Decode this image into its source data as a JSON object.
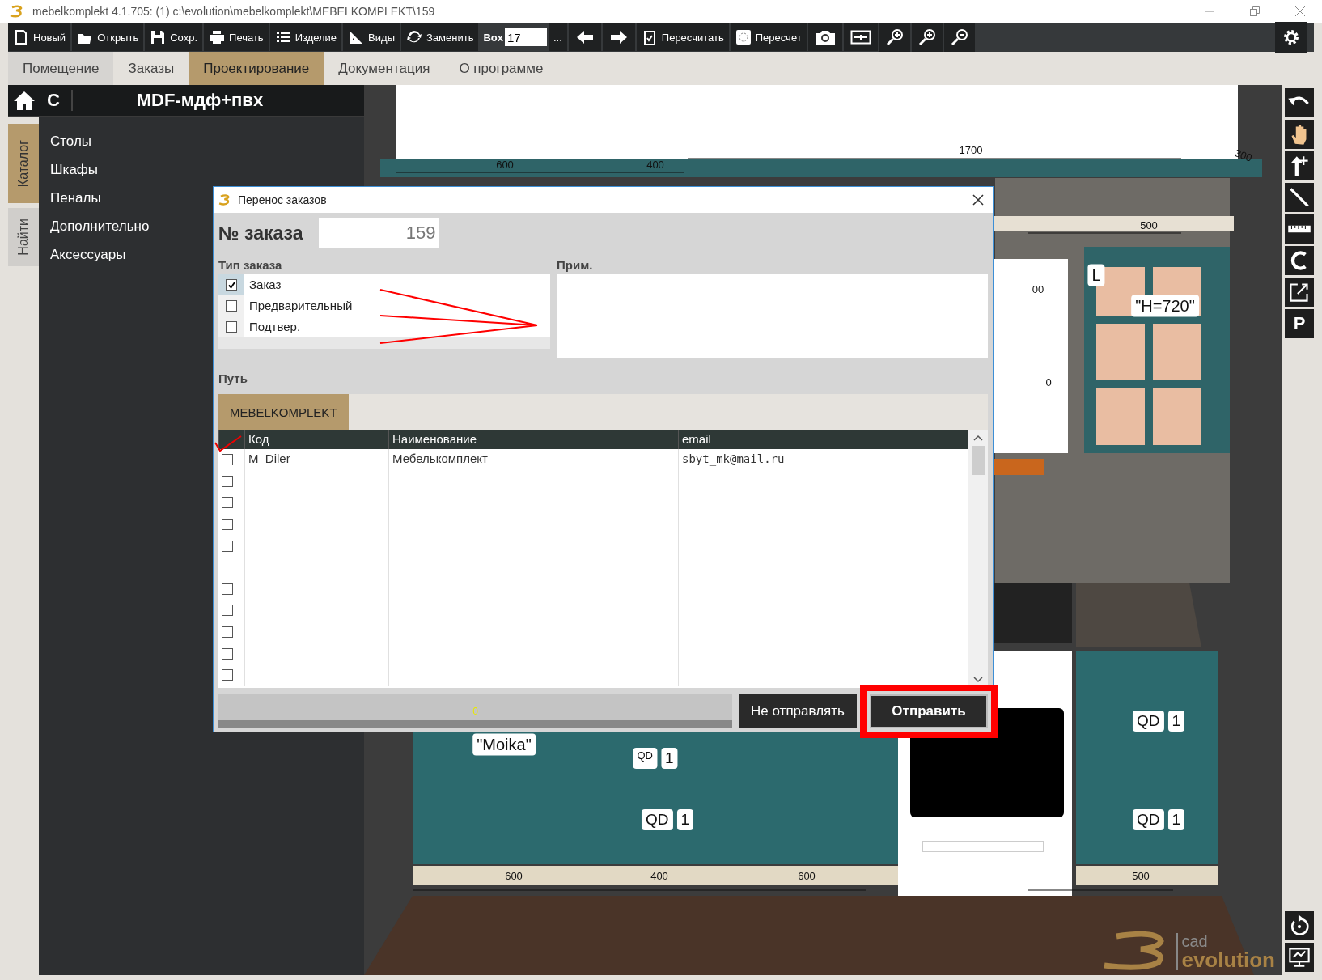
{
  "window": {
    "title": "mebelkomplekt 4.1.705: (1)  c:\\evolution\\mebelkomplekt\\MEBELKOMPLEKT\\159"
  },
  "toolbar": {
    "buttons": [
      "Новый",
      "Открыть",
      "Сохр.",
      "Печать",
      "Изделие",
      "Виды",
      "Заменить"
    ],
    "box_label": "Box",
    "box_value": "17",
    "more": "...",
    "recalc_buttons": [
      "Пересчитать",
      "Пересчет"
    ]
  },
  "tabs": [
    {
      "label": "Помещение",
      "selected": false
    },
    {
      "label": "Заказы",
      "selected": false
    },
    {
      "label": "Проектирование",
      "selected": true
    },
    {
      "label": "Документация",
      "selected": false
    },
    {
      "label": "О программе",
      "selected": false
    }
  ],
  "sidebar": {
    "letter": "C",
    "title": "MDF-мдф+пвх",
    "side_tabs": [
      {
        "label": "Каталог",
        "selected": true
      },
      {
        "label": "Найти",
        "selected": false
      }
    ],
    "items": [
      "Столы",
      "Шкафы",
      "Пеналы",
      "Дополнительно",
      "Аксессуары"
    ]
  },
  "scene": {
    "top_dimensions": [
      "600",
      "400",
      "1700",
      "300",
      "500",
      "00",
      "0"
    ],
    "tags": [
      "L",
      "\"H=720\"",
      "\"Moika\""
    ],
    "qd_labels": [
      {
        "code": "QD",
        "count": "1"
      },
      {
        "code": "QD",
        "count": "1"
      },
      {
        "code": "QD",
        "count": "1"
      },
      {
        "code": "QD",
        "count": "1"
      }
    ],
    "bottom_dimensions": [
      "600",
      "400",
      "600",
      "500"
    ],
    "logo": {
      "line1": "cad",
      "line2": "evolution"
    }
  },
  "right_toolbar": {
    "letter_button": "P"
  },
  "dialog": {
    "title": "Перенос заказов",
    "order_label": "№ заказа",
    "order_value": "159",
    "type_label": "Тип заказа",
    "types": [
      {
        "label": "Заказ",
        "checked": true
      },
      {
        "label": "Предварительный",
        "checked": false
      },
      {
        "label": "Подтвер.",
        "checked": false
      }
    ],
    "note_label": "Прим.",
    "path_label": "Путь",
    "path_tabs": [
      {
        "label": "MEBELKOMPLEKT",
        "selected": true
      }
    ],
    "table": {
      "columns": [
        "Код",
        "Наименование",
        "email"
      ],
      "rows": [
        {
          "kind": "entry",
          "checked": false,
          "code": "M_Diler",
          "name": "Мебелькомплект",
          "email": "sbyt_mk@mail.ru"
        },
        {
          "kind": "entry",
          "checked": false
        },
        {
          "kind": "entry",
          "checked": false
        },
        {
          "kind": "entry",
          "checked": false
        },
        {
          "kind": "entry",
          "checked": false
        },
        {
          "kind": "spacer"
        },
        {
          "kind": "entry",
          "checked": false
        },
        {
          "kind": "entry",
          "checked": false
        },
        {
          "kind": "entry",
          "checked": false
        },
        {
          "kind": "entry",
          "checked": false
        },
        {
          "kind": "entry",
          "checked": false
        }
      ]
    },
    "progress": {
      "reading": "0",
      "level": 1
    },
    "buttons": [
      {
        "label": "Не отправлять",
        "kind": "secondary",
        "highlighted": false
      },
      {
        "label": "Отправить",
        "kind": "primary",
        "highlighted": true
      }
    ]
  }
}
